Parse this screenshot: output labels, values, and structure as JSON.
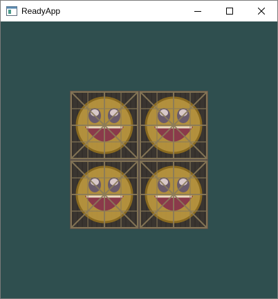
{
  "window": {
    "title": "ReadyApp",
    "client_background": "#2f4f4f"
  },
  "titlebar": {
    "icon": "app-window-icon",
    "buttons": [
      {
        "name": "minimize",
        "icon": "minimize-icon"
      },
      {
        "name": "maximize",
        "icon": "maximize-icon"
      },
      {
        "name": "close",
        "icon": "close-icon"
      }
    ]
  },
  "scene": {
    "texture": "awesome-face-on-wooden-crate",
    "tile_repeat": [
      2,
      2
    ],
    "colors": {
      "wood_dark": "#3a3530",
      "wood_light": "#8a7a5a",
      "face": "#c8a040",
      "mouth": "#8a3a4a",
      "eyes": "#6a5a6a"
    }
  }
}
